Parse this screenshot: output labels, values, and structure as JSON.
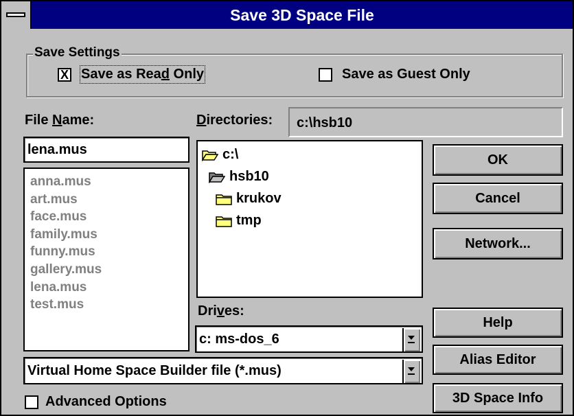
{
  "window": {
    "title": "Save 3D Space File"
  },
  "save_settings": {
    "group_label": "Save Settings",
    "read_only": {
      "label_pre": "Save as Rea",
      "label_ul": "d",
      "label_post": " Only",
      "checked": "X"
    },
    "guest_only": {
      "label": "Save as Guest Only",
      "checked": ""
    }
  },
  "file_name": {
    "label_pre": "File ",
    "label_ul": "N",
    "label_post": "ame:",
    "value": "lena.mus",
    "files": [
      "anna.mus",
      "art.mus",
      "face.mus",
      "family.mus",
      "funny.mus",
      "gallery.mus",
      "lena.mus",
      "test.mus"
    ]
  },
  "directories": {
    "label_ul": "D",
    "label_post": "irectories:",
    "path": "c:\\hsb10",
    "tree": [
      {
        "name": "c:\\",
        "icon": "folder-open-icon"
      },
      {
        "name": "hsb10",
        "icon": "folder-open-icon"
      },
      {
        "name": "krukov",
        "icon": "folder-closed-icon"
      },
      {
        "name": "tmp",
        "icon": "folder-closed-icon"
      }
    ]
  },
  "drives": {
    "label_pre": "Dri",
    "label_ul": "v",
    "label_post": "es:",
    "value": "c: ms-dos_6"
  },
  "file_type": {
    "value": "Virtual Home Space Builder file (*.mus)"
  },
  "advanced": {
    "label": "Advanced Options",
    "checked": ""
  },
  "buttons": {
    "ok": "OK",
    "cancel": "Cancel",
    "network": "Network...",
    "help": "Help",
    "alias_editor": "Alias Editor",
    "space_info": "3D Space Info"
  },
  "colors": {
    "title_bar": "#000080",
    "face": "#c0c0c0",
    "folder": "#ffff80"
  }
}
